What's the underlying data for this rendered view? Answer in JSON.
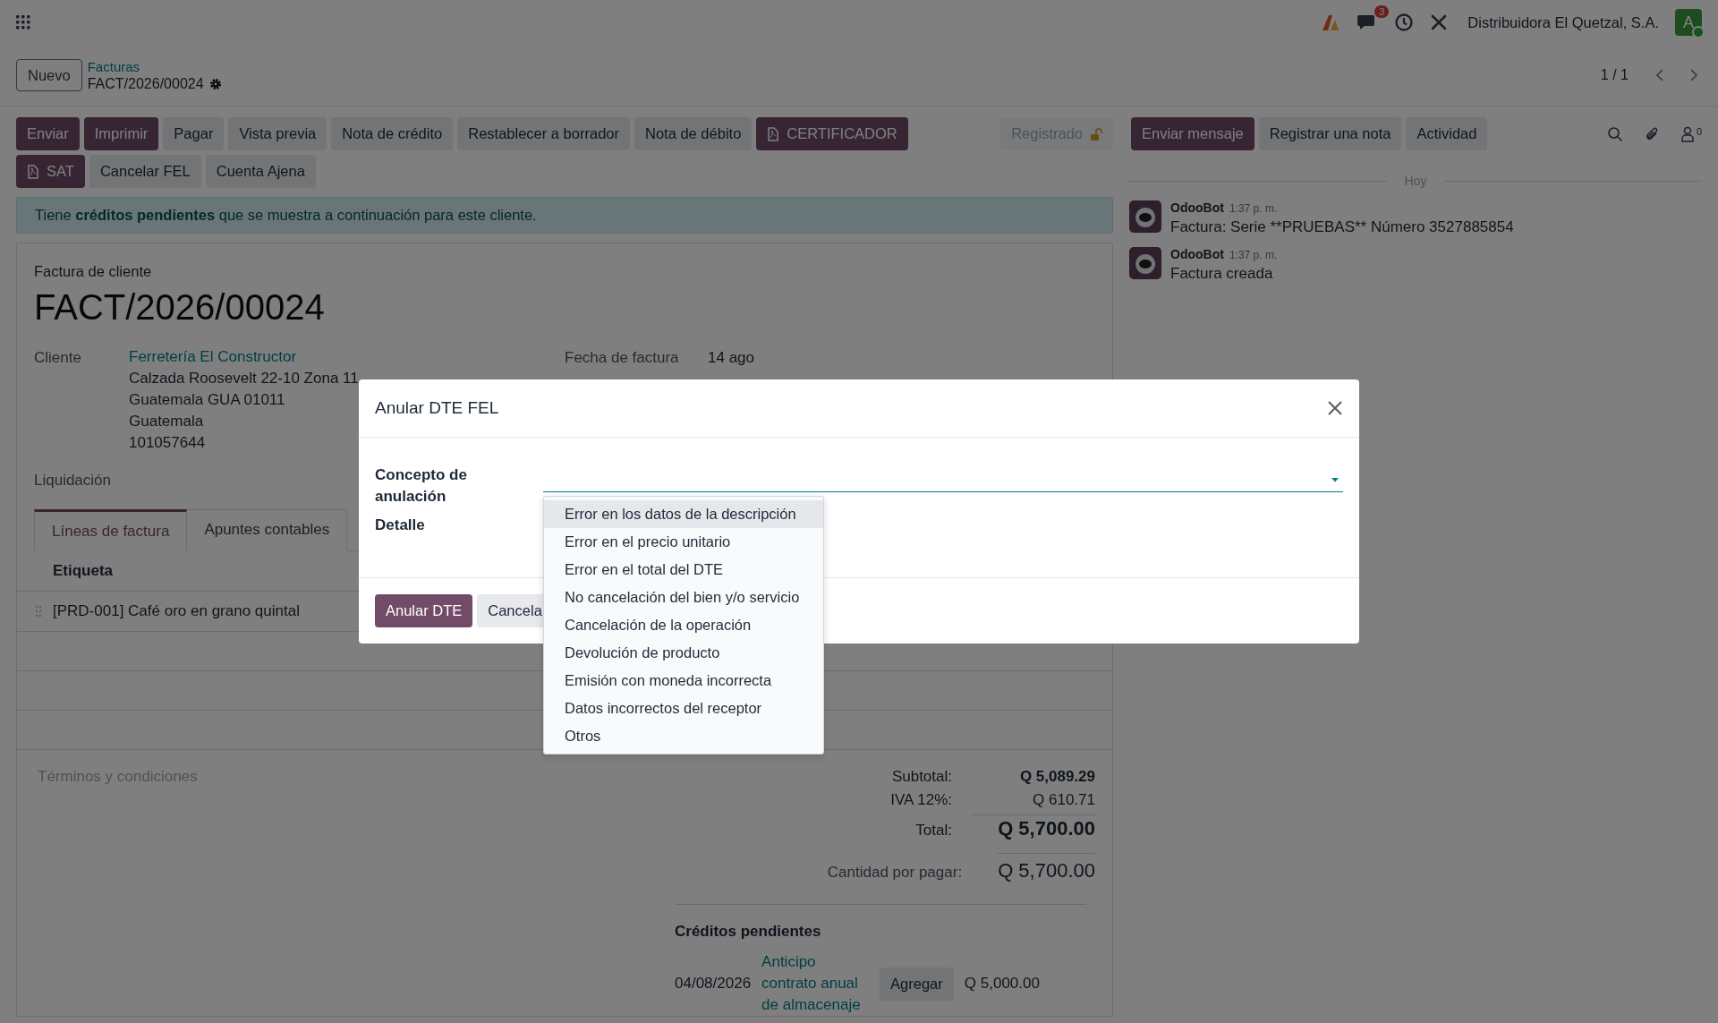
{
  "navbar": {
    "chat_badge": "3",
    "company": "Distribuidora El Quetzal, S.A.",
    "avatar_letter": "A",
    "avatar_online": true
  },
  "control_panel": {
    "new_button": "Nuevo",
    "breadcrumb_parent": "Facturas",
    "record_name": "FACT/2026/00024",
    "pager": "1 / 1"
  },
  "action_rows": [
    [
      {
        "label": "Enviar",
        "kind": "primary"
      },
      {
        "label": "Imprimir",
        "kind": "primary"
      },
      {
        "label": "Pagar",
        "kind": "secondary"
      },
      {
        "label": "Vista previa",
        "kind": "secondary"
      },
      {
        "label": "Nota de crédito",
        "kind": "secondary"
      },
      {
        "label": "Restablecer a borrador",
        "kind": "secondary"
      },
      {
        "label": "Nota de débito",
        "kind": "secondary"
      },
      {
        "label": "CERTIFICADOR",
        "kind": "primary_pdf"
      }
    ],
    [
      {
        "label": "SAT",
        "kind": "primary_pdf"
      },
      {
        "label": "Cancelar FEL",
        "kind": "secondary"
      },
      {
        "label": "Cuenta Ajena",
        "kind": "secondary"
      }
    ]
  ],
  "status": {
    "label": "Registrado",
    "locked": true
  },
  "alert": {
    "text": "Tiene **créditos pendientes** que se muestra a continuación para este cliente."
  },
  "invoice": {
    "type_label": "Factura de cliente",
    "number": "FACT/2026/00024",
    "customer_label": "Cliente",
    "customer_name": "Ferretería El Constructor",
    "customer_address": [
      "Calzada Roosevelt 22-10 Zona 11",
      "Guatemala GUA 01011",
      "Guatemala",
      "101057644"
    ],
    "date_label": "Fecha de factura",
    "date_value": "14 ago",
    "settlement_label": "Liquidación",
    "tabs": [
      {
        "label": "Líneas de factura",
        "selected": true
      },
      {
        "label": "Apuntes contables",
        "selected": false
      }
    ],
    "table": {
      "columns": [
        "Etiqueta"
      ],
      "rows": [
        [
          "[PRD-001] Café oro en grano quintal"
        ]
      ]
    },
    "terms_placeholder": "Términos y condiciones",
    "totals": [
      {
        "label": "Subtotal:",
        "value": "Q 5,089.29",
        "kind": "bold"
      },
      {
        "label": "IVA 12%:",
        "value": "Q 610.71",
        "kind": "plain"
      },
      {
        "label": "Total:",
        "value": "Q 5,700.00",
        "kind": "large"
      }
    ],
    "amount_due": {
      "label": "Cantidad por pagar:",
      "value": "Q 5,700.00"
    },
    "credits": {
      "title": "Créditos pendientes",
      "rows": [
        {
          "date": "04/08/2026",
          "name": "Anticipo contrato anual de almacenaje",
          "button": "Agregar",
          "amount": "Q 5,000.00"
        }
      ]
    }
  },
  "chatter": {
    "buttons": [
      {
        "label": "Enviar mensaje",
        "kind": "primary"
      },
      {
        "label": "Registrar una nota",
        "kind": "secondary"
      },
      {
        "label": "Actividad",
        "kind": "secondary"
      }
    ],
    "followers": "0",
    "date_separator": "Hoy",
    "messages": [
      {
        "author": "OdooBot",
        "time": "1:37 p. m.",
        "body": "Factura: Serie **PRUEBAS** Número 3527885854"
      },
      {
        "author": "OdooBot",
        "time": "1:37 p. m.",
        "body": "Factura creada"
      }
    ]
  },
  "dialog": {
    "title": "Anular DTE FEL",
    "fields": [
      {
        "label": "Concepto de anulación",
        "kind": "select"
      },
      {
        "label": "Detalle",
        "kind": "text"
      }
    ],
    "options": [
      {
        "label": "Error en los datos de la descripción",
        "selected": true
      },
      {
        "label": "Error en el precio unitario",
        "selected": false
      },
      {
        "label": "Error en el total del DTE",
        "selected": false
      },
      {
        "label": "No cancelación del bien y/o servicio",
        "selected": false
      },
      {
        "label": "Cancelación de la operación",
        "selected": false
      },
      {
        "label": "Devolución de producto",
        "selected": false
      },
      {
        "label": "Emisión con moneda incorrecta",
        "selected": false
      },
      {
        "label": "Datos incorrectos del receptor",
        "selected": false
      },
      {
        "label": "Otros",
        "selected": false
      }
    ],
    "buttons": [
      {
        "label": "Anular DTE",
        "kind": "primary"
      },
      {
        "label": "Cancela",
        "kind": "secondary"
      }
    ]
  }
}
